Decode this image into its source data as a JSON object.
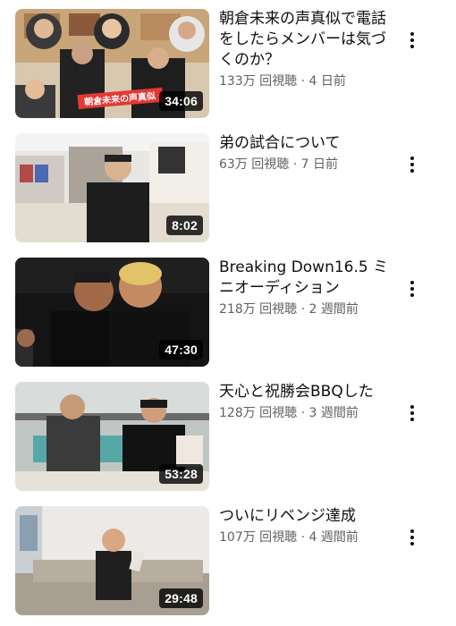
{
  "videos": [
    {
      "title": "朝倉未来の声真似で電話をしたらメンバーは気づくのか？",
      "views": "133万 回視聴",
      "age": "4 日前",
      "duration": "34:06",
      "overlay_text": "朝倉未来の声真似"
    },
    {
      "title": "弟の試合について",
      "views": "63万 回視聴",
      "age": "7 日前",
      "duration": "8:02"
    },
    {
      "title": "Breaking Down16.5 ミニオーディション",
      "views": "218万 回視聴",
      "age": "2 週間前",
      "duration": "47:30"
    },
    {
      "title": "天心と祝勝会BBQした",
      "views": "128万 回視聴",
      "age": "3 週間前",
      "duration": "53:28"
    },
    {
      "title": "ついにリベンジ達成",
      "views": "107万 回視聴",
      "age": "4 週間前",
      "duration": "29:48"
    }
  ],
  "separator": " · ",
  "menu_icon": "more-vert-icon"
}
